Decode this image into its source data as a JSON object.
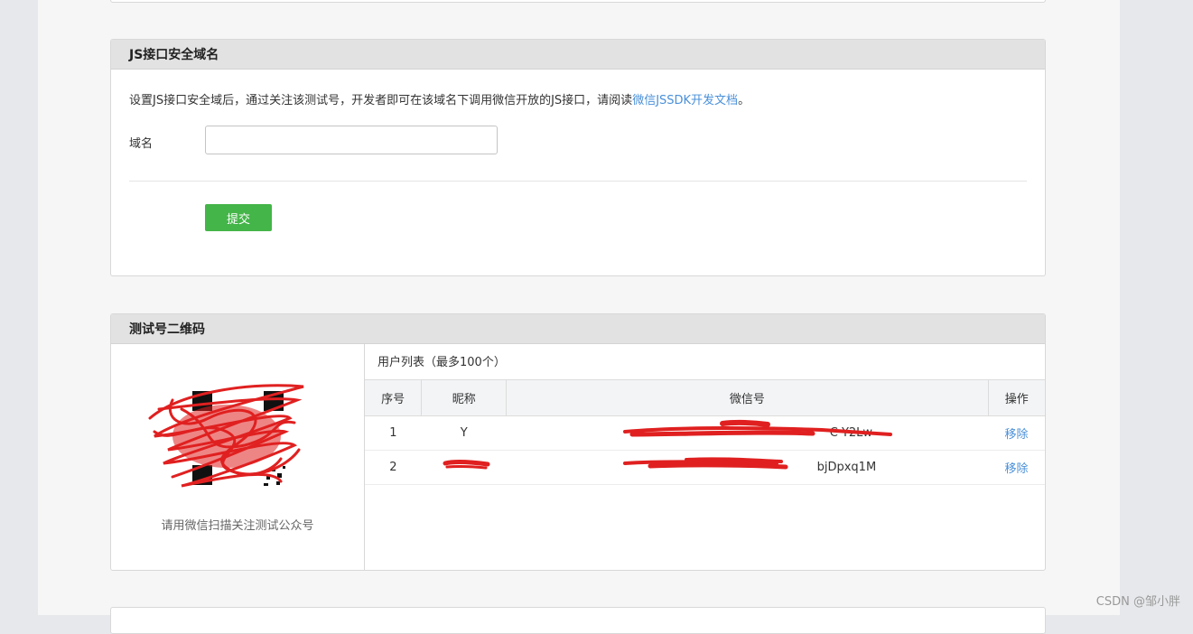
{
  "js_domain": {
    "title": "JS接口安全域名",
    "description": "设置JS接口安全域后，通过关注该测试号，开发者即可在该域名下调用微信开放的JS接口，请阅读",
    "doc_link": "微信JSSDK开发文档",
    "description_end": "。",
    "domain_label": "域名",
    "domain_value": "",
    "submit_label": "提交"
  },
  "qr_section": {
    "title": "测试号二维码",
    "caption": "请用微信扫描关注测试公众号",
    "user_list_title": "用户列表（最多100个）",
    "columns": [
      "序号",
      "昵称",
      "微信号",
      "操作"
    ],
    "rows": [
      {
        "index": "1",
        "nickname": "Y",
        "wechat_id": "C  Y2Lw",
        "action": "移除"
      },
      {
        "index": "2",
        "nickname": "",
        "wechat_id": "bjDpxq1M",
        "action": "移除"
      }
    ]
  },
  "watermark": "CSDN @邹小胖",
  "colors": {
    "accent_green": "#44b549",
    "link_blue": "#4a90d9",
    "redaction": "#e02020"
  }
}
